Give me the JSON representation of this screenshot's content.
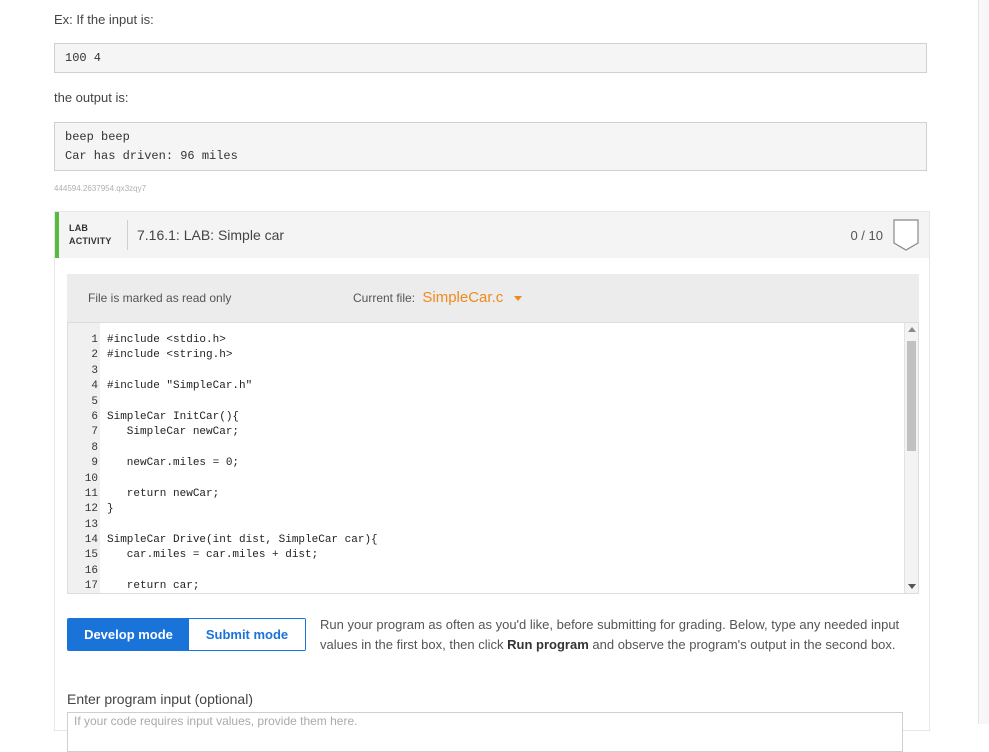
{
  "example": {
    "input_intro": "Ex: If the input is:",
    "input_value": "100 4",
    "output_intro": "the output is:",
    "output_lines": [
      "beep beep",
      "Car has driven: 96 miles"
    ],
    "id_text": "444594.2637954.qx3zqy7"
  },
  "lab": {
    "label_line1": "LAB",
    "label_line2": "ACTIVITY",
    "title": "7.16.1: LAB: Simple car",
    "score": "0 / 10",
    "accent_color": "#59b941"
  },
  "editor": {
    "readonly_label": "File is marked as read only",
    "current_file_label": "Current file:",
    "current_file_name": "SimpleCar.c",
    "lines": [
      {
        "n": "1",
        "code": "#include <stdio.h>"
      },
      {
        "n": "2",
        "code": "#include <string.h>"
      },
      {
        "n": "3",
        "code": ""
      },
      {
        "n": "4",
        "code": "#include \"SimpleCar.h\""
      },
      {
        "n": "5",
        "code": ""
      },
      {
        "n": "6",
        "code": "SimpleCar InitCar(){"
      },
      {
        "n": "7",
        "code": "   SimpleCar newCar;"
      },
      {
        "n": "8",
        "code": ""
      },
      {
        "n": "9",
        "code": "   newCar.miles = 0;"
      },
      {
        "n": "10",
        "code": ""
      },
      {
        "n": "11",
        "code": "   return newCar;"
      },
      {
        "n": "12",
        "code": "}"
      },
      {
        "n": "13",
        "code": ""
      },
      {
        "n": "14",
        "code": "SimpleCar Drive(int dist, SimpleCar car){"
      },
      {
        "n": "15",
        "code": "   car.miles = car.miles + dist;"
      },
      {
        "n": "16",
        "code": ""
      },
      {
        "n": "17",
        "code": "   return car;"
      }
    ]
  },
  "modes": {
    "develop": "Develop mode",
    "submit": "Submit mode",
    "active_color": "#1a73d9"
  },
  "instructions": {
    "part1": "Run your program as often as you'd like, before submitting for grading. Below, type any needed input values in the first box, then click ",
    "run_program": "Run program",
    "part2": " and observe the program's output in the second box."
  },
  "program_input": {
    "label": "Enter program input (optional)",
    "placeholder": "If your code requires input values, provide them here."
  }
}
